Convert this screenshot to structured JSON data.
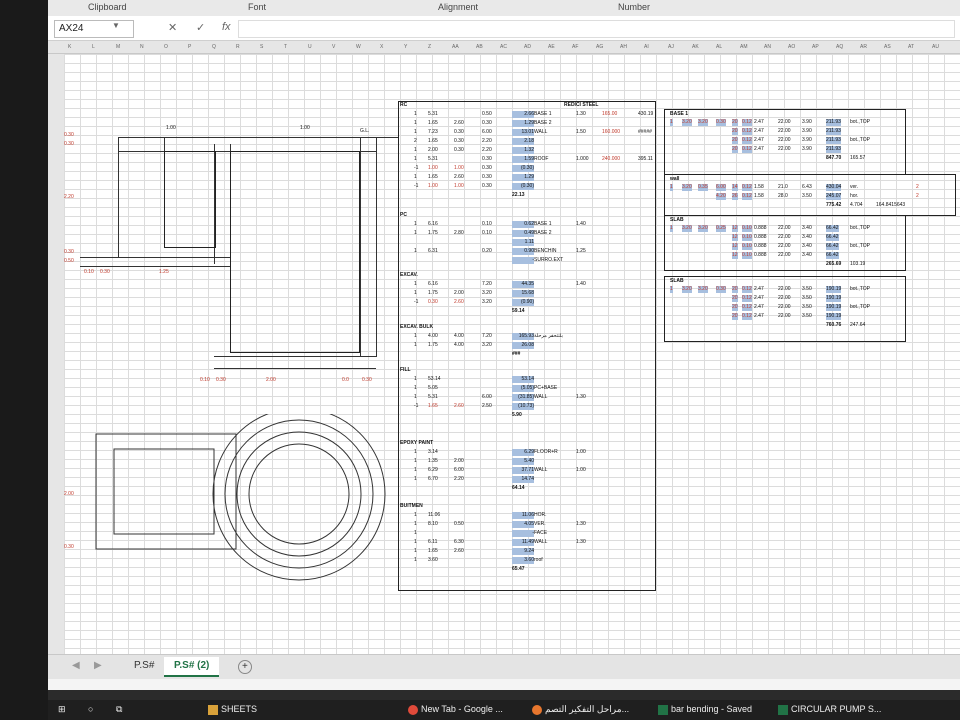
{
  "ribbon": {
    "clipboard": "Clipboard",
    "font": "Font",
    "alignment": "Alignment",
    "number": "Number"
  },
  "formula_bar": {
    "name_box": "AX24",
    "cancel": "✕",
    "enter": "✓",
    "fx": "fx",
    "value": ""
  },
  "columns": [
    "K",
    "L",
    "M",
    "N",
    "O",
    "P",
    "Q",
    "R",
    "S",
    "T",
    "U",
    "V",
    "W",
    "X",
    "Y",
    "Z",
    "AA",
    "AB",
    "AC",
    "AD",
    "AE",
    "AF",
    "AG",
    "AH",
    "AI",
    "AJ",
    "AK",
    "AL",
    "AM",
    "AN",
    "AO",
    "AP",
    "AQ",
    "AR",
    "AS",
    "AT",
    "AU"
  ],
  "drawing": {
    "top_vals": [
      "1.00",
      "1.00",
      "G.L."
    ],
    "left_vals": [
      "0.30",
      "0.30",
      "2.20",
      "0.30",
      "0.50",
      "2.00",
      "0.30"
    ],
    "bottom_vals": [
      "0.10",
      "0.30",
      "1.25",
      "0.10",
      "0.30",
      "2.00",
      "0.0",
      "0.30"
    ]
  },
  "rc_table": {
    "title": "RC",
    "rows": [
      {
        "n": "1",
        "a": "5.31",
        "b": "",
        "c": "0.50",
        "d": "2.66",
        "lbl": "BASE 1",
        "e": "1.30",
        "f": "165.00",
        "g": "430.19"
      },
      {
        "n": "1",
        "a": "1.65",
        "b": "2.60",
        "c": "0.30",
        "d": "1.29",
        "lbl": "BASE 2",
        "e": "",
        "f": "",
        "g": ""
      },
      {
        "n": "1",
        "a": "7.23",
        "b": "0.30",
        "c": "6.00",
        "d": "13.01",
        "lbl": "WALL",
        "e": "1.50",
        "f": "160.000",
        "g": "#####"
      },
      {
        "n": "2",
        "a": "1.65",
        "b": "0.30",
        "c": "2.20",
        "d": "2.18",
        "lbl": "",
        "e": "",
        "f": "",
        "g": ""
      },
      {
        "n": "1",
        "a": "2.00",
        "b": "0.30",
        "c": "2.20",
        "d": "1.32",
        "lbl": "",
        "e": "",
        "f": "",
        "g": ""
      },
      {
        "n": "1",
        "a": "5.31",
        "b": "",
        "c": "0.30",
        "d": "1.59",
        "lbl": "ROOF",
        "e": "1.000",
        "f": "240.000",
        "g": "395.11"
      },
      {
        "n": "-1",
        "a": "1.00",
        "b": "1.00",
        "c": "0.30",
        "d": "(0.30)",
        "lbl": "",
        "e": "",
        "f": "",
        "g": ""
      },
      {
        "n": "1",
        "a": "1.65",
        "b": "2.60",
        "c": "0.30",
        "d": "1.29",
        "lbl": "",
        "e": "",
        "f": "",
        "g": ""
      },
      {
        "n": "-1",
        "a": "1.00",
        "b": "1.00",
        "c": "0.30",
        "d": "(0.30)",
        "lbl": "",
        "e": "",
        "f": "",
        "g": ""
      }
    ],
    "total": "22.13",
    "steel_label": "REDICI STEEL"
  },
  "pc_table": {
    "title": "PC",
    "rows": [
      {
        "n": "1",
        "a": "6.16",
        "b": "",
        "c": "0.10",
        "d": "0.62",
        "lbl": "BASE 1",
        "e": "1.40"
      },
      {
        "n": "1",
        "a": "1.75",
        "b": "2.80",
        "c": "0.10",
        "d": "0.49",
        "lbl": "BASE 2",
        "e": ""
      },
      {
        "n": "",
        "a": "",
        "b": "",
        "c": "",
        "d": "1.11",
        "lbl": "",
        "e": ""
      },
      {
        "n": "1",
        "a": "6.31",
        "b": "",
        "c": "0.20",
        "d": "0.90",
        "lbl": "BENCHIN",
        "e": "1.25"
      },
      {
        "n": "",
        "a": "",
        "b": "",
        "c": "",
        "d": "-",
        "lbl": "SURRO.EXT",
        "e": ""
      }
    ]
  },
  "excav_table": {
    "title": "EXCAV.",
    "rows": [
      {
        "n": "1",
        "a": "6.16",
        "b": "",
        "c": "7.20",
        "d": "44.35",
        "e": "1.40"
      },
      {
        "n": "1",
        "a": "1.75",
        "b": "2.00",
        "c": "3.20",
        "d": "15.68",
        "e": ""
      },
      {
        "n": "-1",
        "a": "0.30",
        "b": "2.60",
        "c": "3.20",
        "d": "(0.90)",
        "e": ""
      }
    ],
    "total": "59.14"
  },
  "excav_bulk": {
    "title": "EXCAV. BULK",
    "rows": [
      {
        "n": "1",
        "a": "4.00",
        "b": "4.00",
        "c": "7.20",
        "d": "165.93",
        "lbl": "بلتتحفر مرحلة"
      },
      {
        "n": "1",
        "a": "1.75",
        "b": "4.00",
        "c": "3.20",
        "d": "26.08",
        "lbl": ""
      }
    ],
    "total": "###"
  },
  "fill_table": {
    "title": "FILL",
    "rows": [
      {
        "n": "1",
        "a": "53.14",
        "b": "",
        "c": "",
        "d": "53.14",
        "lbl": "",
        "e": ""
      },
      {
        "n": "1",
        "a": "5.05",
        "b": "",
        "c": "",
        "d": "(5.05)",
        "lbl": "PC+BASE",
        "e": ""
      },
      {
        "n": "1",
        "a": "5.31",
        "b": "",
        "c": "6.00",
        "d": "(31.85)",
        "lbl": "WALL",
        "e": "1.30"
      },
      {
        "n": "-1",
        "a": "1.65",
        "b": "2.60",
        "c": "2.50",
        "d": "(10.73)",
        "lbl": "",
        "e": ""
      }
    ],
    "total": "5.90"
  },
  "epoxy_table": {
    "title": "EPOXY PAINT",
    "rows": [
      {
        "n": "1",
        "a": "3.14",
        "b": "",
        "d": "6.29",
        "lbl": "FLOOR+R",
        "e": "1.00"
      },
      {
        "n": "1",
        "a": "1.35",
        "b": "2.00",
        "d": "5.40",
        "lbl": "",
        "e": ""
      },
      {
        "n": "1",
        "a": "6.29",
        "b": "6.00",
        "d": "37.71",
        "lbl": "WALL",
        "e": "1.00"
      },
      {
        "n": "1",
        "a": "6.70",
        "b": "2.20",
        "d": "14.74",
        "lbl": "",
        "e": ""
      }
    ],
    "total": "64.14"
  },
  "bitumen_table": {
    "title": "BUITMEN",
    "rows": [
      {
        "n": "1",
        "a": "11.06",
        "b": "",
        "d": "11.06",
        "lbl": "HOR.",
        "e": ""
      },
      {
        "n": "1",
        "a": "8.10",
        "b": "0.50",
        "d": "4.05",
        "lbl": "VER.",
        "e": "1.30"
      },
      {
        "n": "1",
        "a": "",
        "b": "",
        "d": "-",
        "lbl": "FACE",
        "e": ""
      },
      {
        "n": "1",
        "a": "6.11",
        "b": "6.30",
        "d": "11.49",
        "lbl": "WALL",
        "e": "1.30"
      },
      {
        "n": "1",
        "a": "1.65",
        "b": "2.60",
        "d": "9.24",
        "lbl": "",
        "e": ""
      },
      {
        "n": "1",
        "a": "3.60",
        "b": "",
        "d": "3.60",
        "lbl": "roof",
        "e": ""
      }
    ],
    "total": "65.47"
  },
  "base1_table": {
    "title": "BASE 1",
    "rows": [
      {
        "a": "1",
        "b": "3.20",
        "c": "3.20",
        "d": "0.30",
        "e": "20",
        "f": "0.12",
        "g": "2.47",
        "h": "22.00",
        "i": "3.90",
        "j": "211.93",
        "k": "bot.,TOP"
      },
      {
        "a": "",
        "b": "",
        "c": "",
        "d": "",
        "e": "20",
        "f": "0.12",
        "g": "2.47",
        "h": "22.00",
        "i": "3.90",
        "j": "211.93",
        "k": ""
      },
      {
        "a": "",
        "b": "",
        "c": "",
        "d": "",
        "e": "20",
        "f": "0.12",
        "g": "2.47",
        "h": "22.00",
        "i": "3.90",
        "j": "211.93",
        "k": "bot.,TOP"
      },
      {
        "a": "",
        "b": "",
        "c": "",
        "d": "",
        "e": "20",
        "f": "0.12",
        "g": "2.47",
        "h": "22.00",
        "i": "3.90",
        "j": "211.93",
        "k": ""
      }
    ],
    "total": "847.70",
    "extra": "165.57"
  },
  "wall_table": {
    "title": "wall",
    "rows": [
      {
        "a": "1",
        "b": "3.20",
        "c": "0.35",
        "d": "6.00",
        "e": "14",
        "f": "0.12",
        "g": "1.58",
        "h": "21.0",
        "i": "6.43",
        "j": "430.04",
        "k": "ver."
      },
      {
        "a": "",
        "b": "",
        "c": "",
        "d": "4.20",
        "e": "26",
        "f": "0.12",
        "g": "1.58",
        "h": "28.0",
        "i": "3.50",
        "j": "245.07",
        "k": "hor."
      }
    ],
    "total": "775.42",
    "t2": "4.704",
    "t3": "164.8415643",
    "side": [
      "2",
      "2"
    ]
  },
  "slab_table": {
    "title": "SLAB",
    "rows": [
      {
        "a": "1",
        "b": "3.20",
        "c": "3.20",
        "d": "0.25",
        "e": "12",
        "f": "0.10",
        "g": "0.888",
        "h": "22.00",
        "i": "3.40",
        "j": "66.42",
        "k": "bot.,TOP"
      },
      {
        "a": "",
        "b": "",
        "c": "",
        "d": "",
        "e": "12",
        "f": "0.10",
        "g": "0.888",
        "h": "22.00",
        "i": "3.40",
        "j": "66.42",
        "k": ""
      },
      {
        "a": "",
        "b": "",
        "c": "",
        "d": "",
        "e": "12",
        "f": "0.10",
        "g": "0.888",
        "h": "22.00",
        "i": "3.40",
        "j": "66.42",
        "k": "bot.,TOP"
      },
      {
        "a": "",
        "b": "",
        "c": "",
        "d": "",
        "e": "12",
        "f": "0.10",
        "g": "0.888",
        "h": "22.00",
        "i": "3.40",
        "j": "66.42",
        "k": ""
      }
    ],
    "total": "265.69",
    "extra": "103.19"
  },
  "slab2_table": {
    "title": "SLAB",
    "rows": [
      {
        "a": "1",
        "b": "3.20",
        "c": "3.20",
        "d": "0.30",
        "e": "20",
        "f": "0.12",
        "g": "2.47",
        "h": "22.00",
        "i": "3.50",
        "j": "190.19",
        "k": "bot.,TOP"
      },
      {
        "a": "",
        "b": "",
        "c": "",
        "d": "",
        "e": "20",
        "f": "0.12",
        "g": "2.47",
        "h": "22.00",
        "i": "3.50",
        "j": "190.19",
        "k": ""
      },
      {
        "a": "",
        "b": "",
        "c": "",
        "d": "",
        "e": "20",
        "f": "0.12",
        "g": "2.47",
        "h": "22.00",
        "i": "3.50",
        "j": "190.19",
        "k": "bot.,TOP"
      },
      {
        "a": "",
        "b": "",
        "c": "",
        "d": "",
        "e": "20",
        "f": "0.12",
        "g": "2.47",
        "h": "22.00",
        "i": "3.50",
        "j": "190.19",
        "k": ""
      }
    ],
    "total": "760.76",
    "extra": "247.64"
  },
  "sheet_tabs": [
    "P.S#",
    "P.S# (2)"
  ],
  "add_sheet": "+",
  "taskbar": {
    "items": [
      "SHEETS",
      "New Tab - Google ...",
      "مراحل التفكير التصم...",
      "bar bending - Saved",
      "CIRCULAR PUMP S..."
    ]
  },
  "colors": {
    "excel_green": "#217346",
    "highlight": "#a7bfdf",
    "red_text": "#c0392b"
  }
}
